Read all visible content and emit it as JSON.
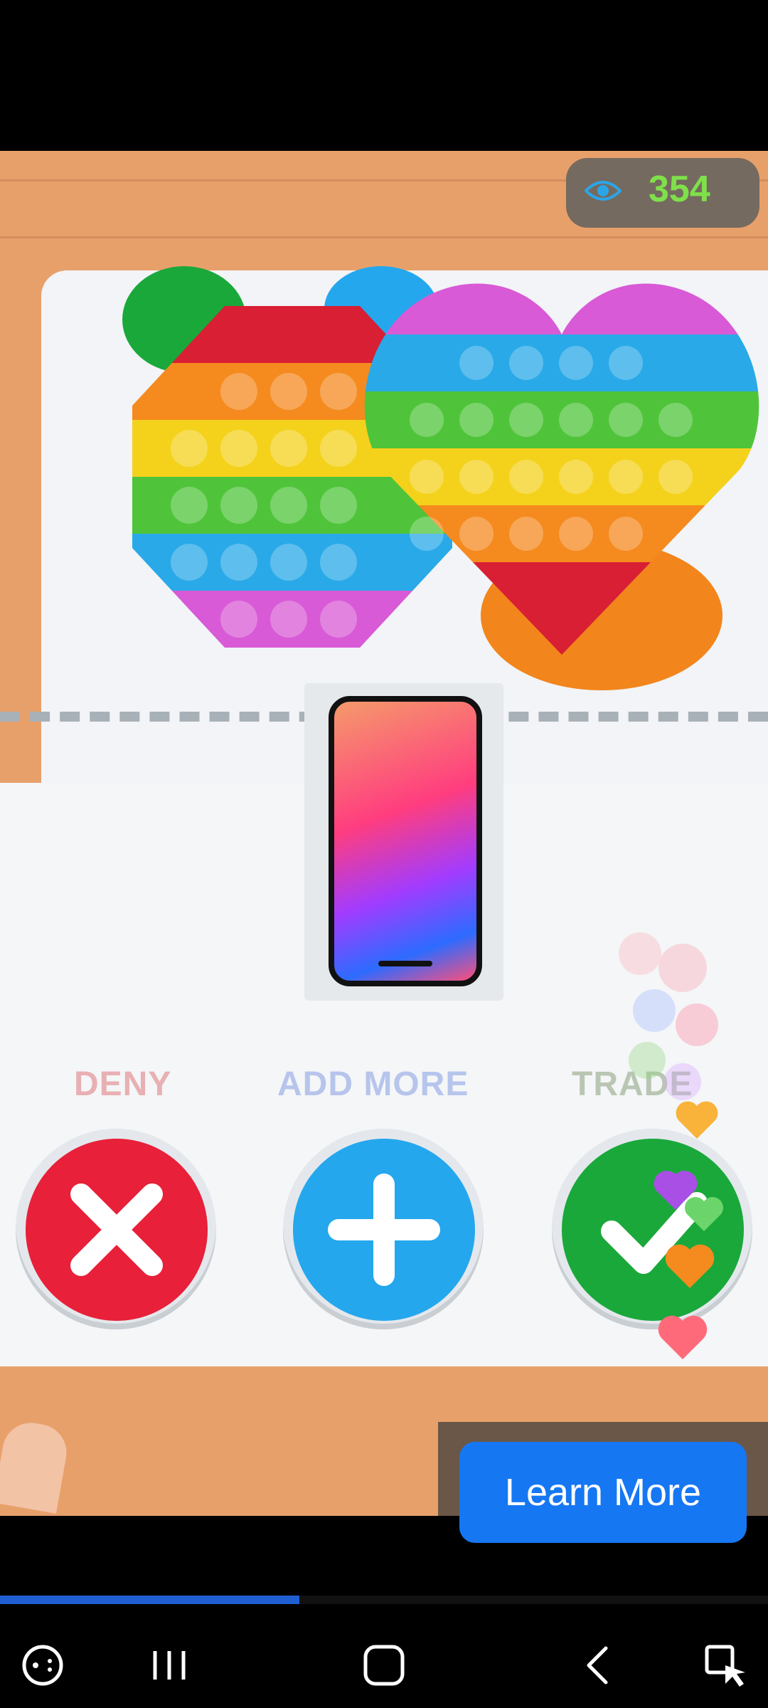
{
  "views": {
    "count": "354",
    "icon": "eye-icon"
  },
  "game": {
    "deny_label": "DENY",
    "add_label": "ADD MORE",
    "trade_label": "TRADE",
    "colors": {
      "deny": "#e8203a",
      "add": "#25a7ee",
      "trade": "#1aa83b"
    }
  },
  "ad": {
    "cta_label": "Learn More"
  },
  "video_progress": {
    "fraction": 0.39
  },
  "nav": {
    "icons": [
      "game-launcher-icon",
      "recent-apps-icon",
      "home-icon",
      "back-icon",
      "accessibility-icon"
    ]
  }
}
